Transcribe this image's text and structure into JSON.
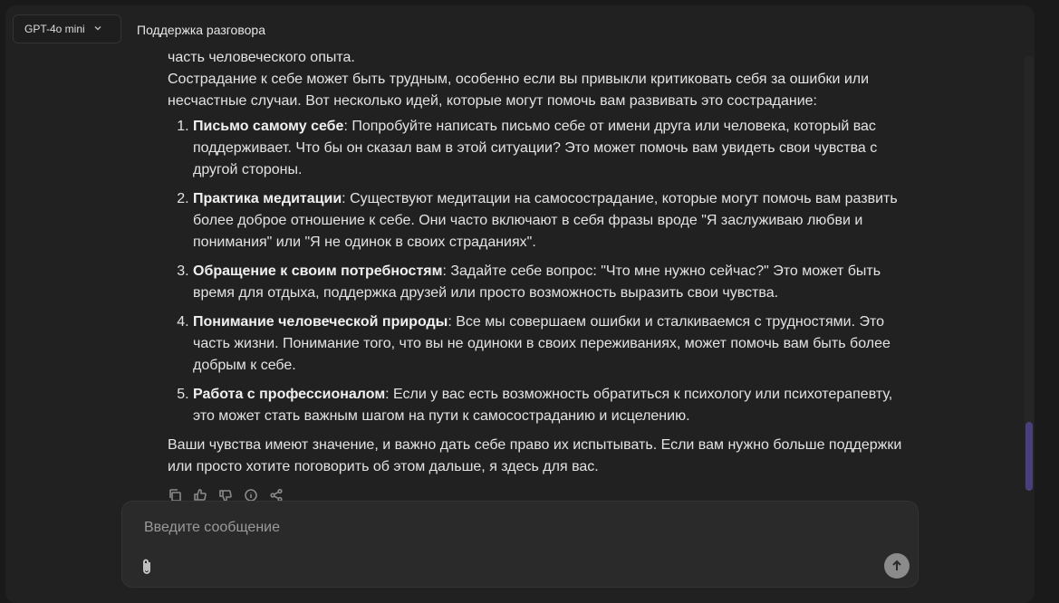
{
  "header": {
    "model_label": "GPT-4o mini",
    "title": "Поддержка разговора"
  },
  "message": {
    "top_cut_text": "часть человеческого опыта.",
    "intro": "Сострадание к себе может быть трудным, особенно если вы привыкли критиковать себя за ошибки или несчастные случаи. Вот несколько идей, которые могут помочь вам развивать это сострадание:",
    "items": [
      {
        "bold": "Письмо самому себе",
        "text": ": Попробуйте написать письмо себе от имени друга или человека, который вас поддерживает. Что бы он сказал вам в этой ситуации? Это может помочь вам увидеть свои чувства с другой стороны."
      },
      {
        "bold": "Практика медитации",
        "text": ": Существуют медитации на самосострадание, которые могут помочь вам развить более доброе отношение к себе. Они часто включают в себя фразы вроде \"Я заслуживаю любви и понимания\" или \"Я не одинок в своих страданиях\"."
      },
      {
        "bold": "Обращение к своим потребностям",
        "text": ": Задайте себе вопрос: \"Что мне нужно сейчас?\" Это может быть время для отдыха, поддержка друзей или просто возможность выразить свои чувства."
      },
      {
        "bold": "Понимание человеческой природы",
        "text": ": Все мы совершаем ошибки и сталкиваемся с трудностями. Это часть жизни. Понимание того, что вы не одиноки в своих переживаниях, может помочь вам быть более добрым к себе."
      },
      {
        "bold": "Работа с профессионалом",
        "text": ": Если у вас есть возможность обратиться к психологу или психотерапевту, это может стать важным шагом на пути к самосостраданию и исцелению."
      }
    ],
    "outro": "Ваши чувства имеют значение, и важно дать себе право их испытывать. Если вам нужно больше поддержки или просто хотите поговорить об этом дальше, я здесь для вас."
  },
  "actions": [
    "copy-icon",
    "thumbs-up-icon",
    "thumbs-down-icon",
    "info-icon",
    "share-icon"
  ],
  "composer": {
    "placeholder": "Введите сообщение"
  },
  "colors": {
    "background": "#212121",
    "composer": "#2a2a2a",
    "scroll_thumb": "#4a3f7a",
    "send_button": "#8b8b8b"
  }
}
